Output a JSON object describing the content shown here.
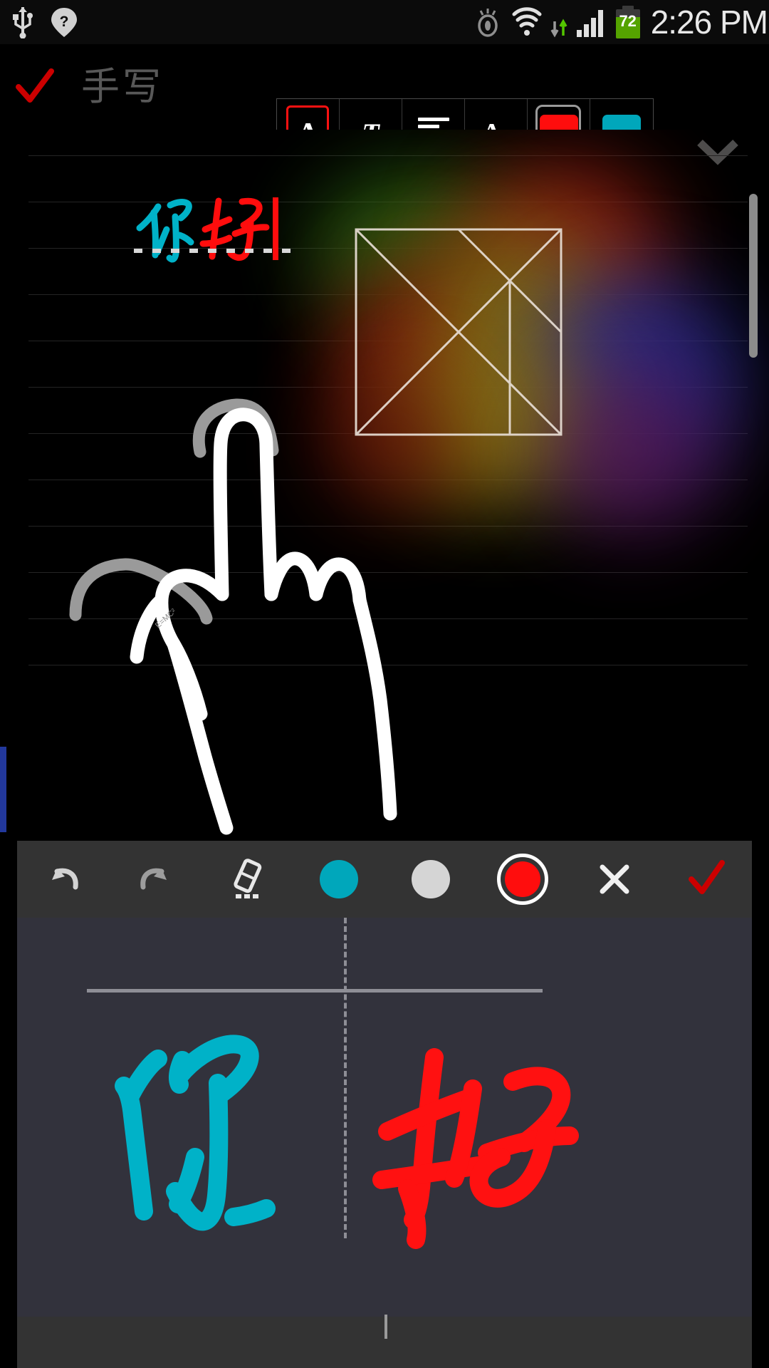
{
  "status_bar": {
    "icons": [
      "usb-icon",
      "location-unknown-icon",
      "smart-stay-eye-icon",
      "wifi-icon",
      "data-transfer-icon",
      "signal-bars-icon"
    ],
    "battery_percent": "72",
    "time": "2:26 PM"
  },
  "top_toolbar": {
    "confirm_label": "✓",
    "title": "手写",
    "tools": [
      {
        "name": "text-style-A",
        "glyph": "A",
        "selected": true
      },
      {
        "name": "text-format-T",
        "glyph": "T",
        "has_dropdown": true
      },
      {
        "name": "text-align",
        "glyph": "align"
      },
      {
        "name": "font-size-Aa",
        "glyph_big": "A",
        "glyph_small": "a"
      },
      {
        "name": "color-swatch-primary",
        "color": "#ff0d0d",
        "selected": true,
        "has_dropdown": true
      },
      {
        "name": "color-swatch-secondary",
        "color": "#00a7bb",
        "selected": false
      }
    ],
    "collapse_icon": "chevron-down-icon"
  },
  "note_canvas": {
    "inline_text": {
      "first_char": "你",
      "first_char_color": "#00b2c8",
      "second_char": "好",
      "second_char_color": "#ff0d0d",
      "caret_color": "#ff0d0d"
    },
    "drawing_labels": {
      "equation": "E=MC²"
    },
    "scrollbar": "vertical-scrollbar",
    "bookmark_color": "#22389c"
  },
  "handwriting_panel": {
    "toolbar": [
      {
        "name": "undo-button",
        "icon": "undo-icon"
      },
      {
        "name": "redo-button",
        "icon": "redo-icon"
      },
      {
        "name": "eraser-button",
        "icon": "eraser-icon"
      },
      {
        "name": "color-cyan-button",
        "icon": "color-dot-icon",
        "color": "#00a7bb",
        "selected": false
      },
      {
        "name": "color-white-button",
        "icon": "color-dot-icon",
        "color": "#d5d5d5",
        "selected": false
      },
      {
        "name": "color-red-button",
        "icon": "color-dot-icon",
        "color": "#ff0d0d",
        "selected": true
      },
      {
        "name": "close-button",
        "icon": "close-x-icon"
      },
      {
        "name": "confirm-button",
        "icon": "check-icon"
      }
    ],
    "ink": {
      "first_char": "你",
      "first_char_color": "#00b2c8",
      "second_char": "好",
      "second_char_color": "#ff1111"
    }
  },
  "colors": {
    "accent_red": "#ff0d0d",
    "accent_cyan": "#00a7bb",
    "panel_bg": "#32323c",
    "toolbar_bg": "#333333",
    "canvas_bg": "#000000"
  }
}
